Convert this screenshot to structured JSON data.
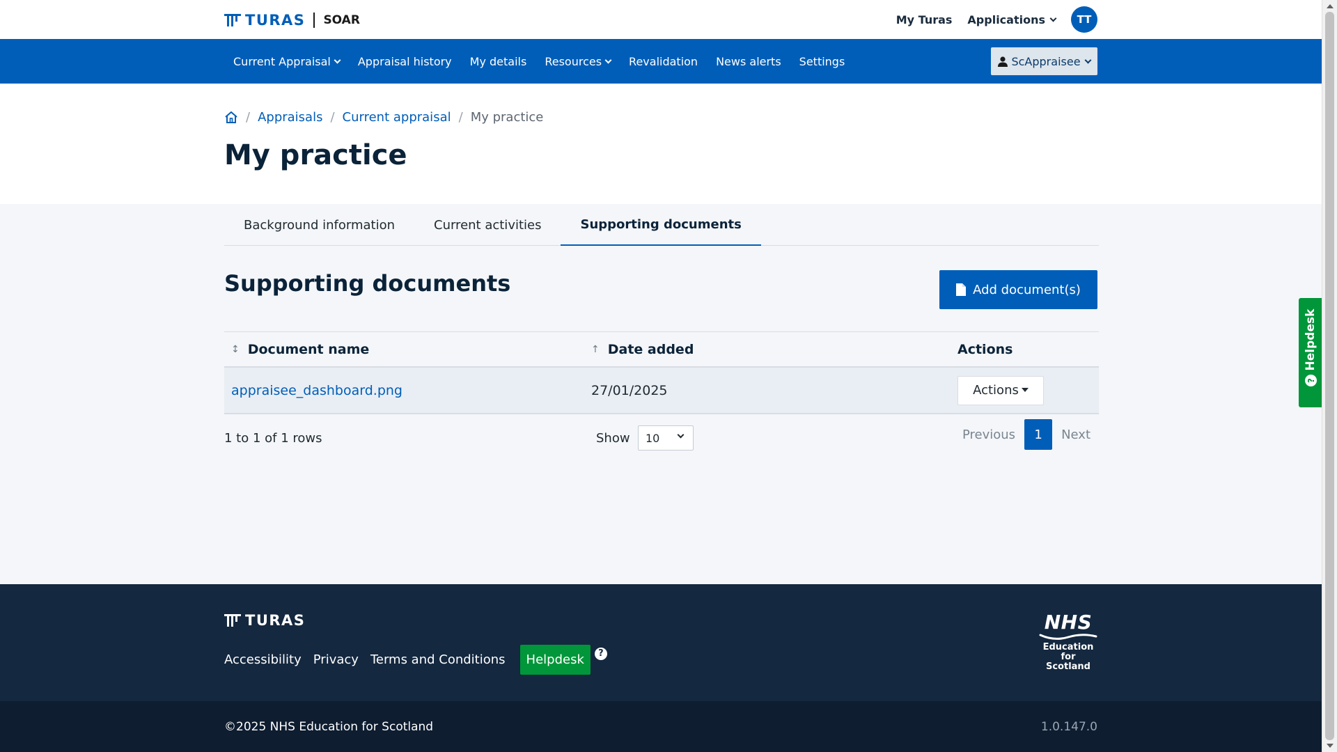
{
  "brand": {
    "name": "TURAS",
    "product": "SOAR"
  },
  "topbar": {
    "my_turas": "My Turas",
    "applications": "Applications",
    "avatar_initials": "TT"
  },
  "nav": {
    "items": [
      {
        "label": "Current Appraisal",
        "dropdown": true
      },
      {
        "label": "Appraisal history",
        "dropdown": false
      },
      {
        "label": "My details",
        "dropdown": false
      },
      {
        "label": "Resources",
        "dropdown": true
      },
      {
        "label": "Revalidation",
        "dropdown": false
      },
      {
        "label": "News alerts",
        "dropdown": false
      },
      {
        "label": "Settings",
        "dropdown": false
      }
    ],
    "user": "ScAppraisee"
  },
  "breadcrumb": {
    "items": [
      "Appraisals",
      "Current appraisal"
    ],
    "current": "My practice"
  },
  "page_title": "My practice",
  "tabs": [
    {
      "label": "Background information",
      "active": false
    },
    {
      "label": "Current activities",
      "active": false
    },
    {
      "label": "Supporting documents",
      "active": true
    }
  ],
  "section": {
    "title": "Supporting documents",
    "add_button": "Add document(s)"
  },
  "table": {
    "columns": [
      "Document name",
      "Date added",
      "Actions"
    ],
    "rows": [
      {
        "name": "appraisee_dashboard.png",
        "date": "27/01/2025",
        "action": "Actions"
      }
    ]
  },
  "pagination": {
    "info": "1 to 1 of 1 rows",
    "show_label": "Show",
    "page_size": "10",
    "previous": "Previous",
    "current_page": "1",
    "next": "Next"
  },
  "side_helpdesk": "Helpdesk",
  "footer": {
    "brand": "TURAS",
    "links": [
      "Accessibility",
      "Privacy",
      "Terms and Conditions"
    ],
    "helpdesk": "Helpdesk",
    "nhs": "NHS",
    "org_lines": [
      "Education",
      "for",
      "Scotland"
    ],
    "copyright": "©2025 NHS Education for Scotland",
    "version": "1.0.147.0"
  },
  "colors": {
    "primary": "#005eb8",
    "helpdesk_green": "#009639",
    "footer": "#14283f",
    "footer_bottom": "#0e1d30"
  }
}
